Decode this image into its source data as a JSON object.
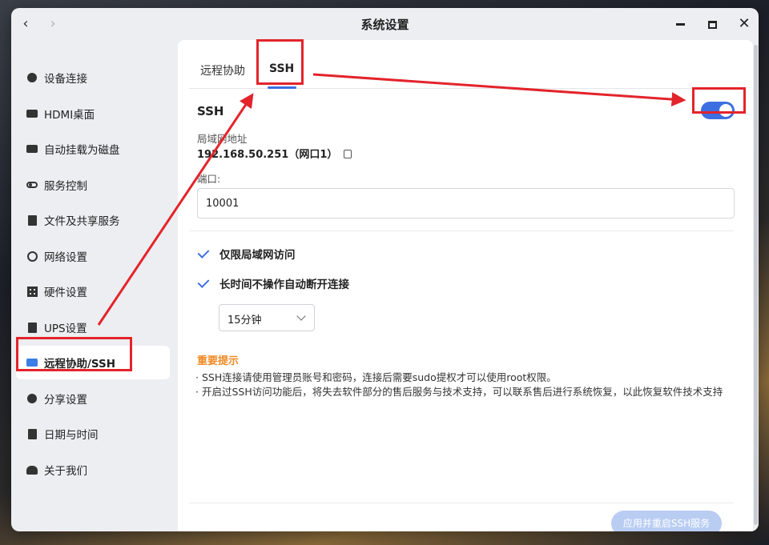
{
  "window": {
    "title": "系统设置",
    "back": "‹",
    "forward": "›",
    "close": "✕"
  },
  "sidebar": {
    "items": [
      {
        "label": "设备连接",
        "icon": "link-icon"
      },
      {
        "label": "HDMI桌面",
        "icon": "monitor-icon"
      },
      {
        "label": "自动挂载为磁盘",
        "icon": "drive-icon"
      },
      {
        "label": "服务控制",
        "icon": "toggle-icon"
      },
      {
        "label": "文件及共享服务",
        "icon": "file-icon"
      },
      {
        "label": "网络设置",
        "icon": "globe-icon"
      },
      {
        "label": "硬件设置",
        "icon": "grid-icon"
      },
      {
        "label": "UPS设置",
        "icon": "battery-icon"
      },
      {
        "label": "远程协助/SSH",
        "icon": "screen-icon",
        "active": true
      },
      {
        "label": "分享设置",
        "icon": "share-icon"
      },
      {
        "label": "日期与时间",
        "icon": "calendar-icon"
      },
      {
        "label": "关于我们",
        "icon": "users-icon"
      }
    ]
  },
  "tabs": [
    {
      "label": "远程协助"
    },
    {
      "label": "SSH",
      "active": true
    }
  ],
  "ssh": {
    "title": "SSH",
    "enabled": true,
    "lan_label": "局域网地址",
    "lan_value": "192.168.50.251（网口1）",
    "port_label": "端口:",
    "port_value": "10001",
    "lan_only_label": "仅限局域网访问",
    "lan_only_checked": true,
    "auto_disconnect_label": "长时间不操作自动断开连接",
    "auto_disconnect_checked": true,
    "timeout_value": "15分钟"
  },
  "notice": {
    "title": "重要提示",
    "lines": [
      "· SSH连接请使用管理员账号和密码，连接后需要sudo提权才可以使用root权限。",
      "· 开启过SSH访问功能后，将失去软件部分的售后服务与技术支持，可以联系售后进行系统恢复，以此恢复软件技术支持"
    ]
  },
  "apply_button": "应用并重启SSH服务",
  "colors": {
    "accent": "#3d6fe2",
    "warning": "#f08a24",
    "annotation": "#e3242b"
  }
}
